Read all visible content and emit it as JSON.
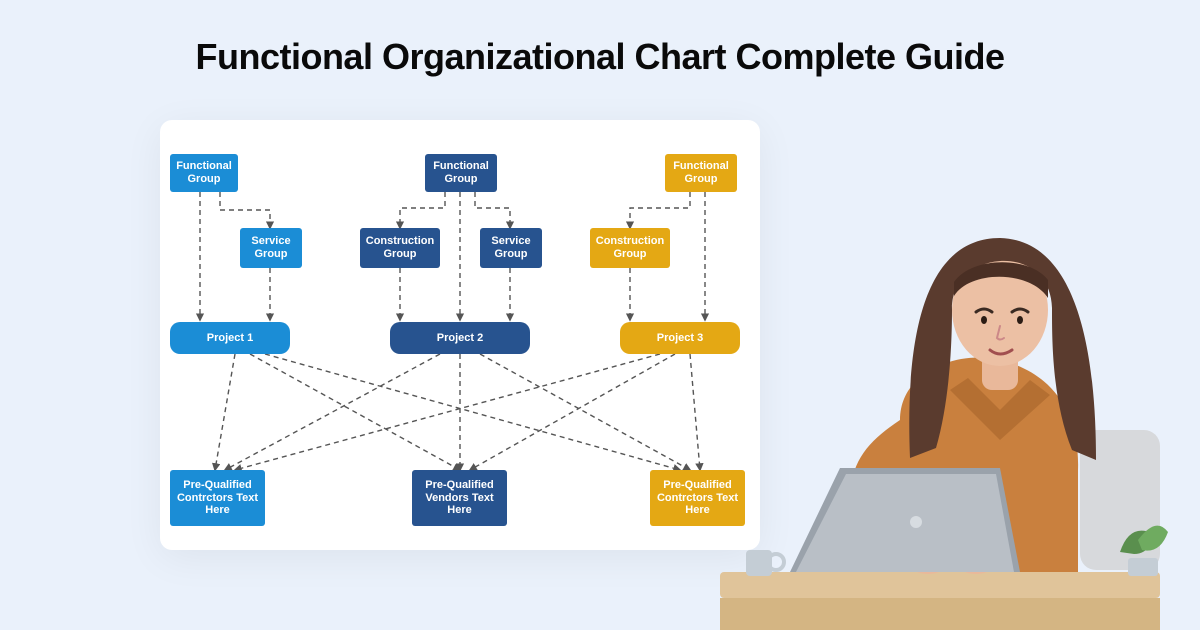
{
  "title": "Functional  Organizational Chart Complete Guide",
  "colors": {
    "azure": "#1b8dd6",
    "navy": "#27538f",
    "gold": "#e4a814",
    "page_bg": "#eaf1fb",
    "card_bg": "#ffffff"
  },
  "diagram": {
    "columns": [
      {
        "tint": "azure",
        "functional": "Functional Group",
        "service": "Service Group",
        "project": "Project 1",
        "bottom": "Pre-Qualified Contrctors Text Here"
      },
      {
        "tint": "navy",
        "functional": "Functional Group",
        "construction": "Construction Group",
        "service": "Service Group",
        "project": "Project 2",
        "bottom": "Pre-Qualified Vendors Text Here"
      },
      {
        "tint": "gold",
        "functional": "Functional Group",
        "construction": "Construction Group",
        "project": "Project 3",
        "bottom": "Pre-Qualified Contrctors Text Here"
      }
    ]
  },
  "illustration": {
    "description": "woman-at-laptop",
    "shirt_color": "#c9803e",
    "laptop_color": "#b9bfc6",
    "desk_color": "#e0c49a"
  }
}
